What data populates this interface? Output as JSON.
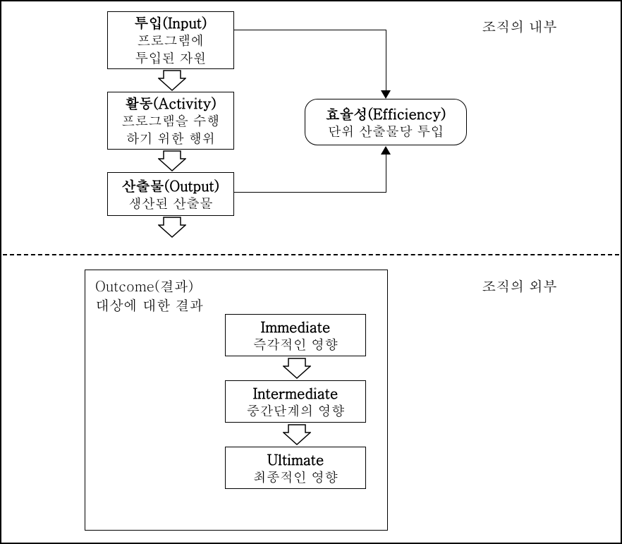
{
  "labels": {
    "internal": "조직의 내부",
    "external": "조직의 외부"
  },
  "input": {
    "title": "투입(Input)",
    "sub1": "프로그램에",
    "sub2": "투입된 자원"
  },
  "activity": {
    "title": "활동(Activity)",
    "sub1": "프로그램을 수행",
    "sub2": "하기 위한 행위"
  },
  "output": {
    "title": "산출물(Output)",
    "sub": "생산된 산출물"
  },
  "efficiency": {
    "title": "효율성(Efficiency)",
    "sub": "단위 산출물당 투입"
  },
  "outcome": {
    "title": "Outcome(결과)",
    "sub": "대상에 대한 결과",
    "immediate": {
      "title": "Immediate",
      "sub": "즉각적인 영향"
    },
    "intermediate": {
      "title": "Intermediate",
      "sub": "중간단계의 영향"
    },
    "ultimate": {
      "title": "Ultimate",
      "sub": "최종적인 영향"
    }
  }
}
